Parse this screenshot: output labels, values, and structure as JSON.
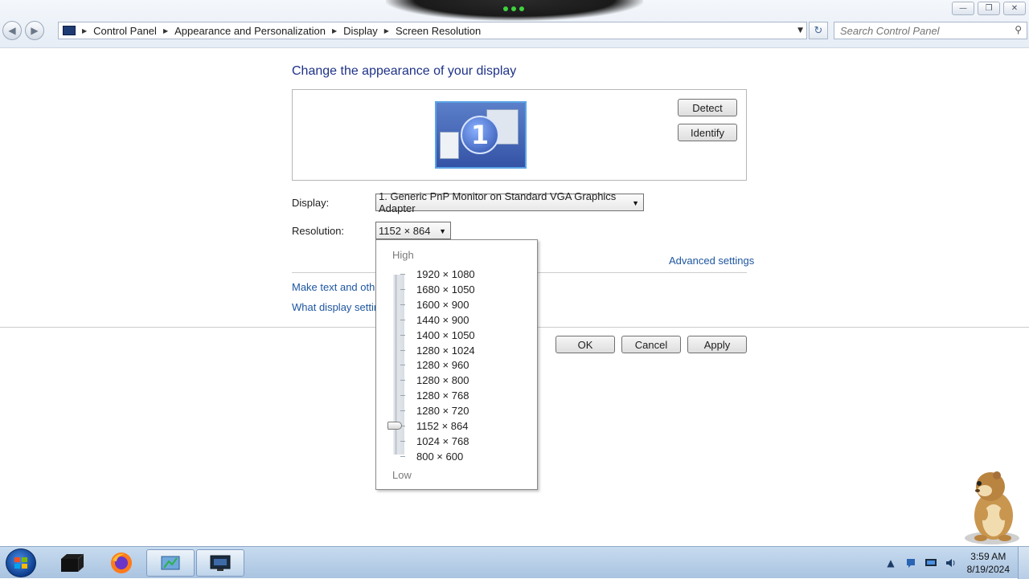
{
  "window": {
    "minimize_symbol": "—",
    "maximize_symbol": "❐",
    "close_symbol": "✕"
  },
  "nav": {
    "back_symbol": "◀",
    "forward_symbol": "▶"
  },
  "breadcrumb": {
    "items": [
      "Control Panel",
      "Appearance and Personalization",
      "Display",
      "Screen Resolution"
    ],
    "separator": "▶",
    "dropdown_symbol": "▼"
  },
  "refresh_symbol": "↻",
  "search": {
    "placeholder": "Search Control Panel",
    "icon": "search-icon",
    "icon_glyph": "⚲"
  },
  "page": {
    "title": "Change the appearance of your display",
    "monitor_number": "1",
    "detect_label": "Detect",
    "identify_label": "Identify",
    "display_label": "Display:",
    "display_value": "1. Generic PnP Monitor on Standard VGA Graphics Adapter",
    "resolution_label": "Resolution:",
    "resolution_value": "1152 × 864",
    "dropdown_arrow": "▼",
    "advanced_link": "Advanced settings",
    "link_text_size": "Make text and other",
    "link_what_settings": "What display setting",
    "ok_label": "OK",
    "cancel_label": "Cancel",
    "apply_label": "Apply"
  },
  "resolution_menu": {
    "high_label": "High",
    "low_label": "Low",
    "options": [
      "1920 × 1080",
      "1680 × 1050",
      "1600 × 900",
      "1440 × 900",
      "1400 × 1050",
      "1280 × 1024",
      "1280 × 960",
      "1280 × 800",
      "1280 × 768",
      "1280 × 720",
      "1152 × 864",
      "1024 × 768",
      "800 × 600"
    ],
    "selected_index": 10
  },
  "taskbar": {
    "items": [
      "start-button",
      "terminal-icon",
      "firefox-icon",
      "control-panel-icon",
      "display-settings-icon"
    ],
    "tray_up_arrow": "▲",
    "time": "3:59 AM",
    "date": "8/19/2024"
  },
  "colors": {
    "heading": "#1e3287",
    "link": "#1e56a0",
    "taskbar": "#b7cde6"
  }
}
